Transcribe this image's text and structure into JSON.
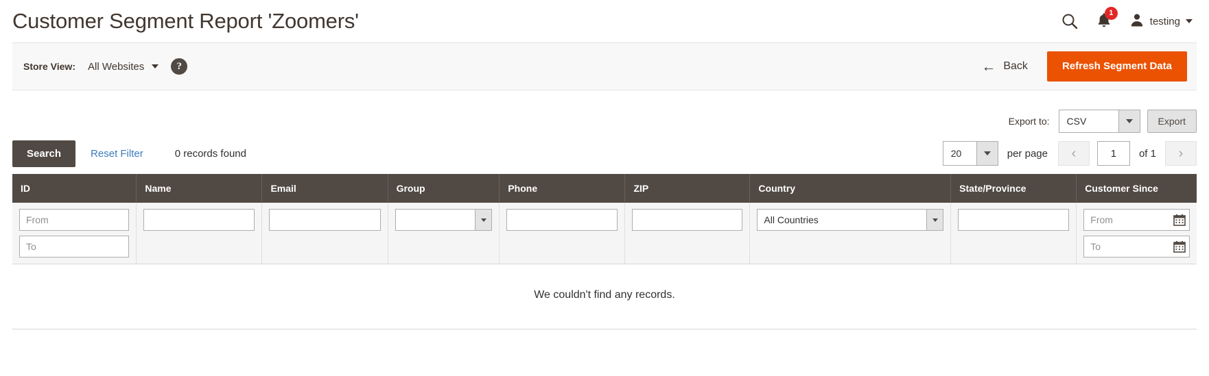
{
  "header": {
    "title": "Customer Segment Report 'Zoomers'",
    "search_icon": "search-icon",
    "notifications": {
      "icon": "bell-icon",
      "count": "1"
    },
    "user": {
      "avatar_icon": "user-avatar-icon",
      "name": "testing",
      "caret_icon": "chevron-down-icon"
    }
  },
  "toolbar": {
    "store_view_label": "Store View:",
    "store_view_value": "All Websites",
    "store_view_caret": "chevron-down-icon",
    "help_icon": "question-mark-icon",
    "help_label": "?",
    "back_label": "Back",
    "back_arrow": "arrow-left-icon",
    "refresh_label": "Refresh Segment Data"
  },
  "export": {
    "label": "Export to:",
    "selected_format": "CSV",
    "button_label": "Export",
    "dropdown_icon": "chevron-down-icon"
  },
  "search_bar": {
    "search_label": "Search",
    "reset_label": "Reset Filter",
    "records_found": "0 records found"
  },
  "pagination": {
    "per_page_value": "20",
    "per_page_label": "per page",
    "prev_icon": "chevron-left-icon",
    "next_icon": "chevron-right-icon",
    "current_page": "1",
    "of_label": "of 1"
  },
  "grid": {
    "columns": [
      {
        "label": "ID"
      },
      {
        "label": "Name"
      },
      {
        "label": "Email"
      },
      {
        "label": "Group"
      },
      {
        "label": "Phone"
      },
      {
        "label": "ZIP"
      },
      {
        "label": "Country"
      },
      {
        "label": "State/Province"
      },
      {
        "label": "Customer Since"
      }
    ],
    "filters": {
      "id_from_placeholder": "From",
      "id_to_placeholder": "To",
      "name_value": "",
      "email_value": "",
      "group_value": "",
      "phone_value": "",
      "zip_value": "",
      "country_value": "All Countries",
      "state_value": "",
      "since_from_placeholder": "From",
      "since_to_placeholder": "To",
      "calendar_icon": "calendar-icon"
    },
    "empty_message": "We couldn't find any records."
  },
  "colors": {
    "accent_orange": "#eb5202",
    "header_dark": "#514943",
    "link_blue": "#3b7cbd",
    "badge_red": "#e22626"
  }
}
